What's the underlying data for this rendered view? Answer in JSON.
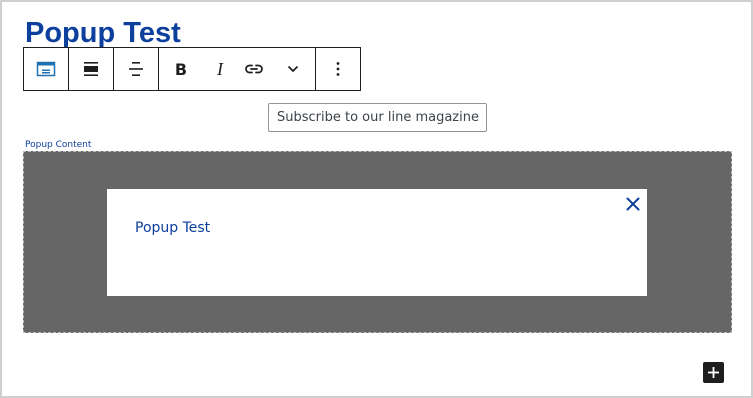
{
  "page": {
    "title": "Popup Test"
  },
  "toolbar": {
    "groups": [
      {
        "items": [
          {
            "icon": "block-type-icon"
          }
        ]
      },
      {
        "items": [
          {
            "icon": "align-wide-icon"
          }
        ]
      },
      {
        "items": [
          {
            "icon": "align-center-icon"
          }
        ]
      },
      {
        "items": [
          {
            "icon": "bold-icon",
            "label": "B"
          },
          {
            "icon": "italic-icon",
            "label": "I"
          },
          {
            "icon": "link-icon"
          },
          {
            "icon": "chevron-down-icon"
          }
        ]
      },
      {
        "items": [
          {
            "icon": "more-options-icon"
          }
        ]
      }
    ]
  },
  "subscribe_field": {
    "value": "Subscribe to our line magazine"
  },
  "block": {
    "label": "Popup Content"
  },
  "popup": {
    "text": "Popup Test",
    "close_icon": "close-icon"
  },
  "add_block": {
    "icon": "plus-icon"
  },
  "colors": {
    "accent": "#0d3f9c",
    "overlay": "#666666",
    "toolbar_border": "#1e1e1e",
    "block_type_icon": "#2271b1"
  }
}
